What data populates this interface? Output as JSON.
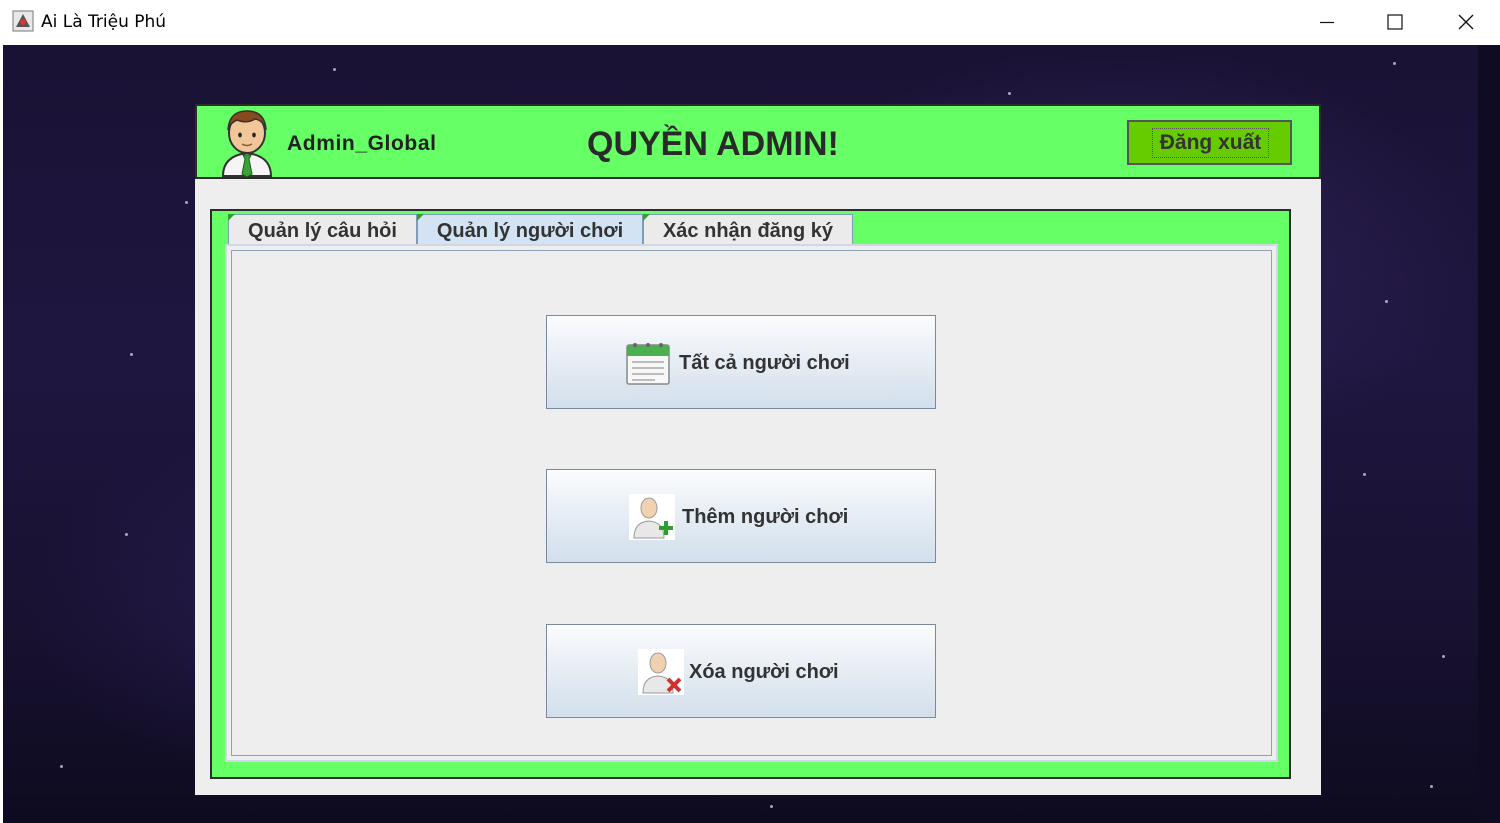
{
  "window": {
    "title": "Ai Là Triệu Phú",
    "minimize_icon": "minimize-icon",
    "maximize_icon": "maximize-icon",
    "close_icon": "close-icon"
  },
  "header": {
    "username": "Admin_Global",
    "title": "QUYỀN ADMIN!",
    "logout_label": "Đăng xuất",
    "avatar_icon": "user-avatar-icon",
    "colors": {
      "header_bg": "#66ff66",
      "logout_bg": "#66cc00"
    }
  },
  "tabs": [
    {
      "label": "Quản lý câu hỏi",
      "selected": false
    },
    {
      "label": "Quản lý người chơi",
      "selected": true
    },
    {
      "label": "Xác nhận đăng ký",
      "selected": false
    }
  ],
  "actions": {
    "all_players": {
      "label": "Tất cả người chơi",
      "icon": "calendar-list-icon"
    },
    "add_player": {
      "label": "Thêm người chơi",
      "icon": "user-add-icon"
    },
    "delete_player": {
      "label": "Xóa người chơi",
      "icon": "user-delete-icon"
    }
  }
}
